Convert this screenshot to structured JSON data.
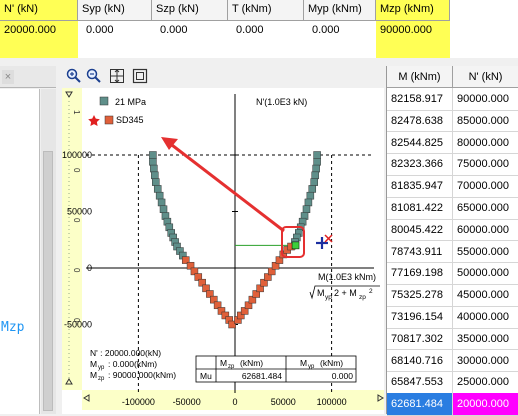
{
  "top_grid": {
    "headers": [
      "N' (kN)",
      "Syp (kN)",
      "Szp (kN)",
      "T (kNm)",
      "Myp (kNm)",
      "Mzp (kNm)"
    ],
    "values": [
      "20000.000",
      "0.000",
      "0.000",
      "0.000",
      "0.000",
      "90000.000"
    ]
  },
  "left_panel": {
    "label": "Mzp"
  },
  "toolbar": {
    "icons": [
      "zoom-in-icon",
      "zoom-out-icon",
      "fit-icon",
      "frame-icon"
    ]
  },
  "plot": {
    "legend": [
      {
        "label": "21 MPa",
        "color": "#5f8f8a"
      },
      {
        "label": "SD345",
        "color": "#e0603a"
      }
    ],
    "axis_y_label": "N'(1.0E3 kN)",
    "axis_x_label": "M(1.0E3 kNm)",
    "axis_x_formula_a": "M",
    "axis_x_formula_b": "yp",
    "axis_x_formula_c": "2 + M",
    "axis_x_formula_d": "zp",
    "axis_x_formula_e": "2",
    "y_ticks": [
      "100000",
      "50000",
      "0",
      "-50000"
    ],
    "x_ticks": [
      "-100000",
      "-50000",
      "0",
      "50000",
      "100000"
    ],
    "info_n": "N' : 20000.000(kN)",
    "info_myp": "M",
    "info_myp_sub": "yp",
    "info_myp_val": ": 0.000(kNm)",
    "info_mzp": "M",
    "info_mzp_sub": "zp",
    "info_mzp_val": ": 90000.000(kNm)",
    "result_hdr_mzp": "M",
    "result_hdr_mzp_sub": "zp",
    "result_hdr_mzp_unit": "(kNm)",
    "result_hdr_myp": "M",
    "result_hdr_myp_sub": "yp",
    "result_hdr_myp_unit": "(kNm)",
    "result_row_label": "Mu",
    "result_mzp": "62681.484",
    "result_myp": "0.000"
  },
  "chart_data": {
    "type": "scatter",
    "series": [
      {
        "name": "21 MPa",
        "x": [
          -85000,
          -85000,
          -84000,
          -83000,
          -82000,
          -80000,
          -78000,
          -76000,
          -74000,
          -72000,
          -70000,
          -68000,
          -66000,
          -64000,
          -62000,
          -60000,
          -57000,
          -54000,
          85000,
          85000,
          84000,
          83000,
          82000,
          80000,
          78000,
          76000,
          74000,
          72000,
          70000,
          68000,
          66000,
          64000,
          62000
        ],
        "y": [
          100000,
          94000,
          88000,
          82000,
          76000,
          70000,
          64000,
          58000,
          52000,
          46000,
          41000,
          36000,
          31000,
          27000,
          23000,
          19000,
          15000,
          11000,
          100000,
          94000,
          88000,
          82000,
          76000,
          70000,
          64000,
          58000,
          52000,
          46000,
          41000,
          36000,
          31000,
          27000,
          23000
        ]
      },
      {
        "name": "SD345",
        "x": [
          -51000,
          -46000,
          -42000,
          -38000,
          -34000,
          -30000,
          -26000,
          -22000,
          -18000,
          -14000,
          -10000,
          -6000,
          -3000,
          3000,
          6000,
          10000,
          14000,
          18000,
          22000,
          26000,
          30000,
          34000,
          38000,
          42000,
          46000,
          50000,
          54000,
          58000
        ],
        "y": [
          7000,
          2000,
          -3000,
          -8000,
          -13000,
          -18000,
          -23000,
          -28000,
          -33000,
          -38000,
          -42000,
          -46000,
          -50000,
          -46000,
          -42000,
          -38000,
          -33000,
          -28000,
          -23000,
          -18000,
          -13000,
          -8000,
          -3000,
          2000,
          7000,
          12000,
          16000,
          19000
        ]
      }
    ],
    "highlight_point": {
      "x": 62681.484,
      "y": 20000
    },
    "xlabel": "M(1.0E3 kNm)",
    "ylabel": "N'(1.0E3 kN)",
    "xlim": [
      -130000,
      130000
    ],
    "ylim": [
      -80000,
      125000
    ],
    "grid": false,
    "legend": "top-left"
  },
  "right_table": {
    "headers": [
      "M (kNm)",
      "N' (kN)"
    ],
    "rows": [
      [
        "82158.917",
        "90000.000"
      ],
      [
        "82478.638",
        "85000.000"
      ],
      [
        "82544.825",
        "80000.000"
      ],
      [
        "82323.366",
        "75000.000"
      ],
      [
        "81835.947",
        "70000.000"
      ],
      [
        "81081.422",
        "65000.000"
      ],
      [
        "80045.422",
        "60000.000"
      ],
      [
        "78743.911",
        "55000.000"
      ],
      [
        "77169.198",
        "50000.000"
      ],
      [
        "75325.278",
        "45000.000"
      ],
      [
        "73196.154",
        "40000.000"
      ],
      [
        "70817.302",
        "35000.000"
      ],
      [
        "68140.716",
        "30000.000"
      ],
      [
        "65847.553",
        "25000.000"
      ],
      [
        "62681.484",
        "20000.000"
      ]
    ]
  }
}
